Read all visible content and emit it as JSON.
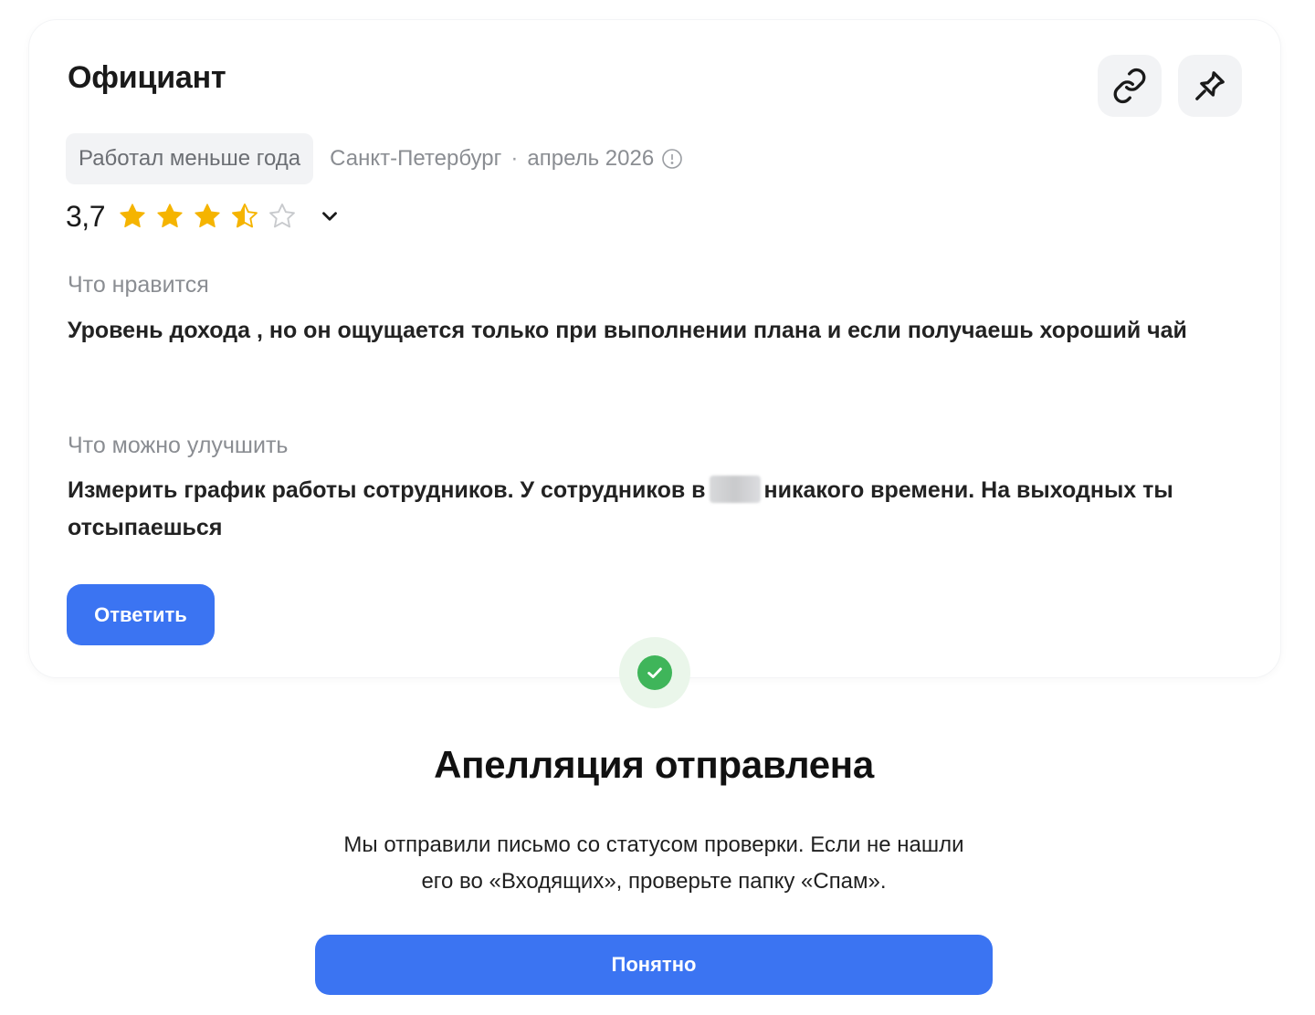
{
  "review": {
    "job_title": "Официант",
    "employment_chip": "Работал меньше года",
    "city": "Санкт-Петербург",
    "separator": "·",
    "date": "апрель 2026",
    "rating_text": "3,7",
    "rating_value": 3.7,
    "stars": [
      "full",
      "full",
      "full",
      "half",
      "empty"
    ],
    "likes_label": "Что нравится",
    "likes_text": "Уровень дохода , но он ощущается только при выполнении плана и если получаешь хороший чай",
    "improve_label": "Что можно улучшить",
    "improve_text_before": "Измерить график работы сотрудников. У сотрудников в",
    "improve_text_after": "никакого времени. На выходных ты отсыпаешься",
    "reply_label": "Ответить"
  },
  "icons": {
    "link": "link-icon",
    "pin": "pin-icon",
    "info": "info-icon",
    "expand": "chevron-down-icon",
    "success": "check-circle-icon"
  },
  "modal": {
    "title": "Апелляция отправлена",
    "text": "Мы отправили письмо со статусом проверки. Если не нашли его во «Входящих», проверьте папку «Спам».",
    "ok_label": "Понятно"
  },
  "colors": {
    "primary": "#3b74f2",
    "star": "#f5b400",
    "star_empty": "#c8cacd",
    "success": "#3fb55a",
    "success_bg": "#eaf6ea"
  }
}
